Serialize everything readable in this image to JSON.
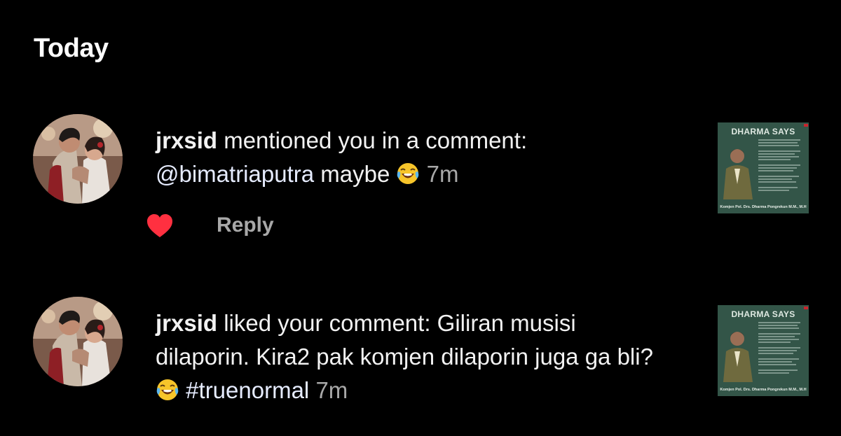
{
  "header": {
    "title": "Today"
  },
  "notifications": [
    {
      "username": "jrxsid",
      "action": " mentioned you in a comment:",
      "mention": "@bimatriaputra",
      "body": " maybe ",
      "emoji": "face-with-tears-of-joy",
      "time": "7m",
      "liked": true,
      "reply_label": "Reply",
      "thumbnail": {
        "title": "DHARMA SAYS",
        "caption": "Komjen Pol. Drs. Dharma Pongrekun M.M., M.H"
      }
    },
    {
      "username": "jrxsid",
      "action": " liked your comment: Giliran musisi dilaporin. Kira2 pak komjen dilaporin juga ga bli?",
      "emoji": "face-with-tears-of-joy",
      "hashtag": "#truenormal",
      "time": "7m",
      "thumbnail": {
        "title": "DHARMA SAYS",
        "caption": "Komjen Pol. Drs. Dharma Pongrekun M.M., M.H"
      }
    }
  ],
  "colors": {
    "background": "#000000",
    "text": "#f2f2f2",
    "secondary": "#a8a8a8",
    "heart": "#ff3040",
    "thumbnail_bg": "#2f4f43"
  }
}
